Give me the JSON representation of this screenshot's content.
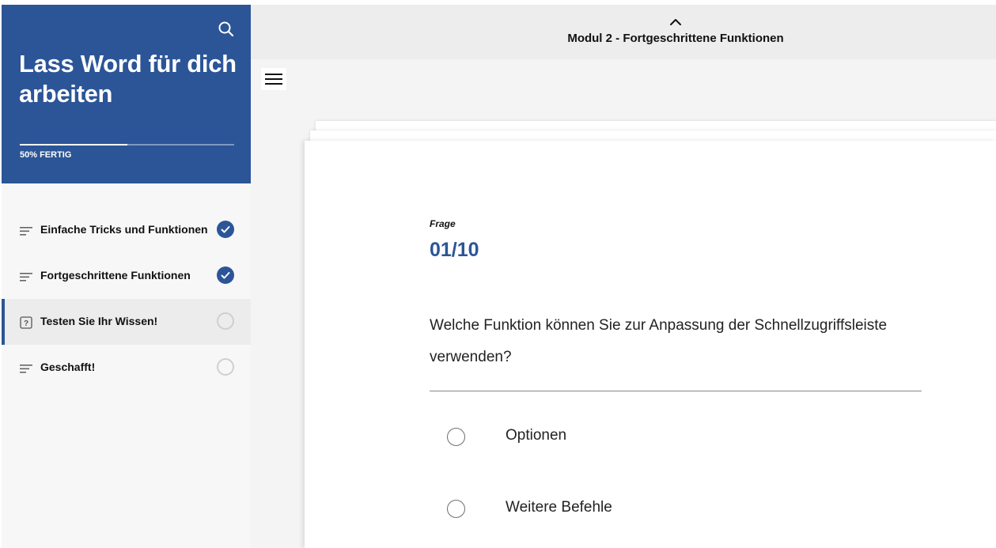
{
  "colors": {
    "brand": "#2b5597",
    "sidebar_bg": "#f7f7f7",
    "main_bg": "#f4f4f4"
  },
  "sidebar": {
    "search_icon": "search-icon",
    "title": "Lass Word für dich arbeiten",
    "progress": {
      "label": "50% FERTIG",
      "percent": 50
    },
    "lessons": [
      {
        "label": "Einfache Tricks und Funktionen",
        "icon": "lines-icon",
        "status": "complete"
      },
      {
        "label": "Fortgeschrittene Funktionen",
        "icon": "lines-icon",
        "status": "complete"
      },
      {
        "label": "Testen Sie Ihr Wissen!",
        "icon": "quiz-icon",
        "status": "incomplete",
        "active": true
      },
      {
        "label": "Geschafft!",
        "icon": "lines-icon",
        "status": "incomplete"
      }
    ]
  },
  "topbar": {
    "up_icon": "chevron-up-icon",
    "module_title": "Modul 2 - Fortgeschrittene Funktionen",
    "menu_icon": "hamburger-menu-icon"
  },
  "quiz": {
    "question_label": "Frage",
    "question_number": "01/10",
    "question_text": "Welche Funktion können Sie zur Anpassung der Schnellzugriffsleiste verwenden?",
    "options": [
      {
        "label": "Optionen"
      },
      {
        "label": "Weitere Befehle"
      }
    ]
  }
}
